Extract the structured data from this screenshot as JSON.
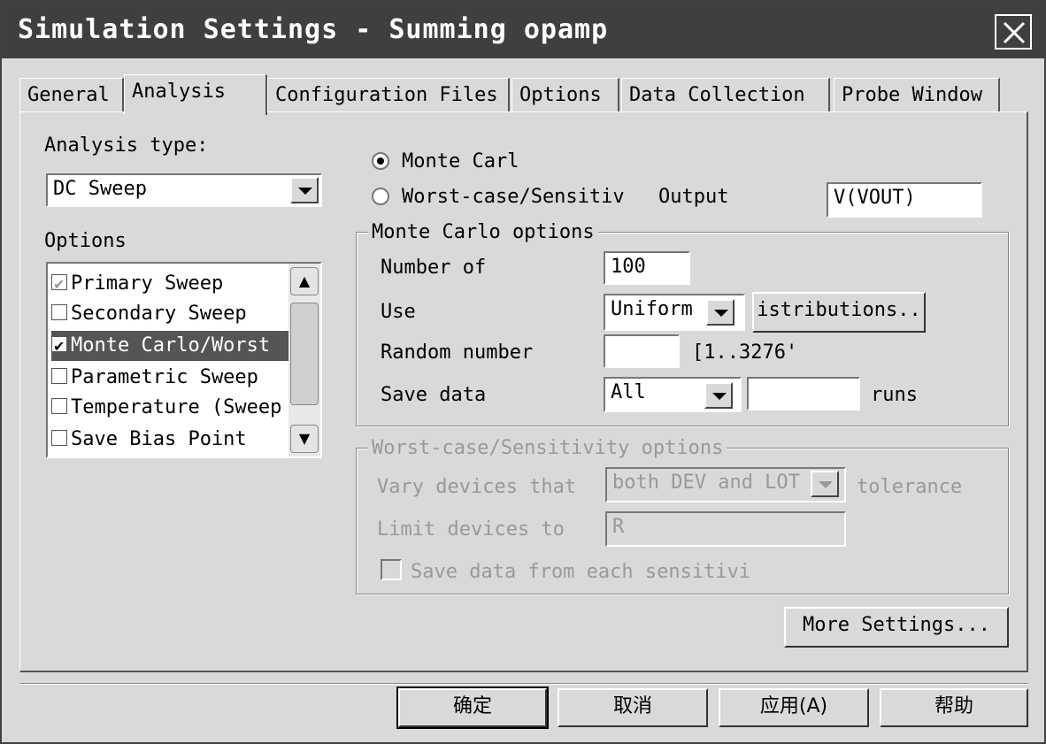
{
  "window": {
    "title": "Simulation Settings - Summing opamp"
  },
  "tabs": [
    {
      "label": "General"
    },
    {
      "label": "Analysis"
    },
    {
      "label": "Configuration Files"
    },
    {
      "label": "Options"
    },
    {
      "label": "Data Collection"
    },
    {
      "label": "Probe Window"
    }
  ],
  "left": {
    "analysis_type_label": "Analysis type:",
    "analysis_type_value": "DC Sweep",
    "options_label": "Options",
    "options": [
      {
        "label": "Primary Sweep",
        "state": "checked-disabled"
      },
      {
        "label": "Secondary Sweep",
        "state": "unchecked"
      },
      {
        "label": "Monte Carlo/Worst",
        "state": "checked-selected"
      },
      {
        "label": "Parametric Sweep",
        "state": "unchecked"
      },
      {
        "label": "Temperature (Sweep",
        "state": "unchecked"
      },
      {
        "label": "Save Bias Point",
        "state": "unchecked"
      }
    ]
  },
  "mode": {
    "monte_carlo_label": "Monte Carl",
    "worst_case_label": "Worst-case/Sensitiv",
    "output_label": "Output",
    "output_value": "V(VOUT)"
  },
  "monte_carlo": {
    "group_title": "Monte Carlo options",
    "num_runs_label": "Number of",
    "num_runs_value": "100",
    "use_label": "Use",
    "use_value": "Uniform",
    "distributions_button": "istributions..",
    "random_label": "Random number",
    "random_value": "",
    "random_range": "[1..3276'",
    "save_label": "Save data",
    "save_value": "All",
    "save_runs_value": "",
    "runs_label": "runs"
  },
  "worst_case": {
    "group_title": "Worst-case/Sensitivity options",
    "vary_label": "Vary devices that",
    "vary_value": "both DEV and LOT",
    "tolerance_label": "tolerance",
    "limit_label": "Limit devices to",
    "limit_value": "R",
    "save_each_label": "Save data from each sensitivi"
  },
  "buttons": {
    "more_settings": "More Settings...",
    "ok": "确定",
    "cancel": "取消",
    "apply": "应用(A)",
    "help": "帮助"
  }
}
